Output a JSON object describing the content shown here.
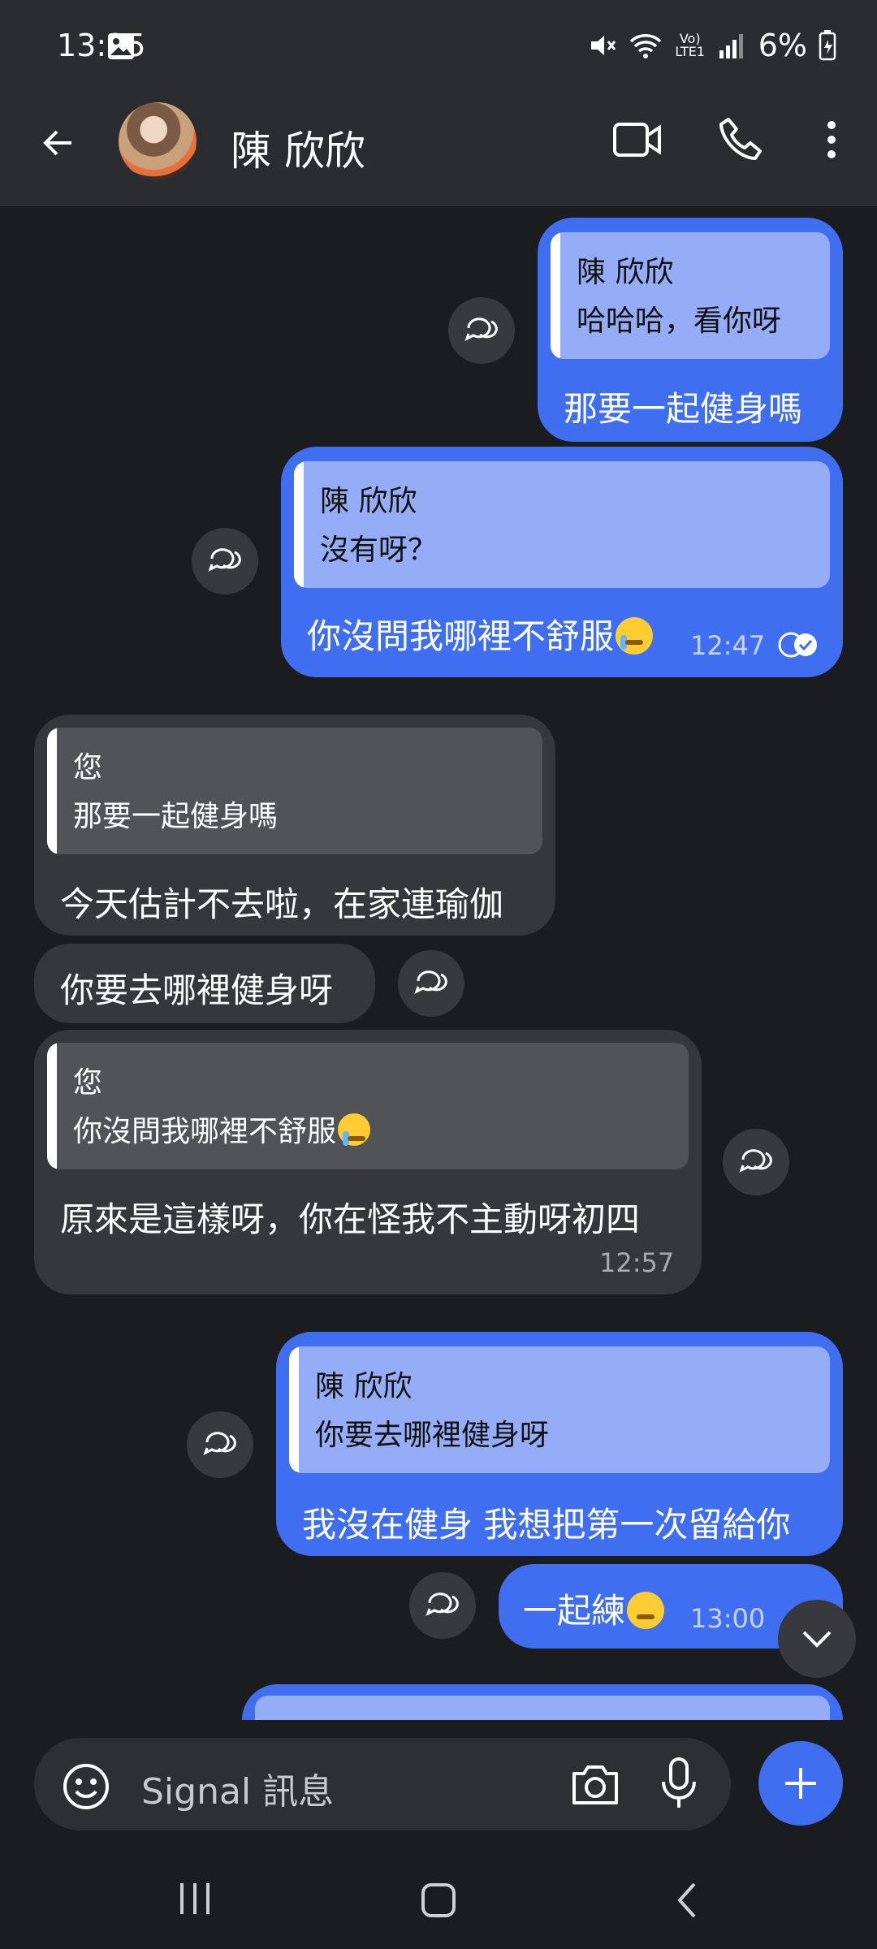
{
  "status_bar": {
    "time": "13:25",
    "battery": "6%",
    "network": "Vo) LTE1"
  },
  "header": {
    "contact_name": "陳 欣欣"
  },
  "messages": [
    {
      "quote_author": "陳 欣欣",
      "quote_text": "哈哈哈，看你呀",
      "text": "那要一起健身嗎"
    },
    {
      "quote_author": "陳 欣欣",
      "quote_text": "沒有呀？",
      "text": "你沒問我哪裡不舒服",
      "time": "12:47"
    },
    {
      "quote_author": "您",
      "quote_text": "那要一起健身嗎",
      "text": "今天估計不去啦，在家連瑜伽"
    },
    {
      "text": "你要去哪裡健身呀"
    },
    {
      "quote_author": "您",
      "quote_text": "你沒問我哪裡不舒服",
      "text": "原來是這樣呀，你在怪我不主動呀初四",
      "time": "12:57"
    },
    {
      "quote_author": "陳 欣欣",
      "quote_text": "你要去哪裡健身呀",
      "text": "我沒在健身 我想把第一次留給你"
    },
    {
      "text": "一起練",
      "time": "13:00"
    }
  ],
  "compose": {
    "placeholder": "Signal 訊息"
  },
  "icons": {
    "back": "arrow-left-icon",
    "video": "video-call-icon",
    "phone": "phone-icon",
    "more": "more-vert-icon",
    "react": "reaction-icon",
    "emoji": "emoji-icon",
    "camera": "camera-icon",
    "mic": "mic-icon",
    "plus": "plus-icon",
    "scroll": "chevron-down-icon"
  },
  "colors": {
    "outgoing_bubble": "#3f6ff0",
    "incoming_bubble": "#36373b",
    "background": "#1b1c1f",
    "header": "#2b2c30"
  }
}
